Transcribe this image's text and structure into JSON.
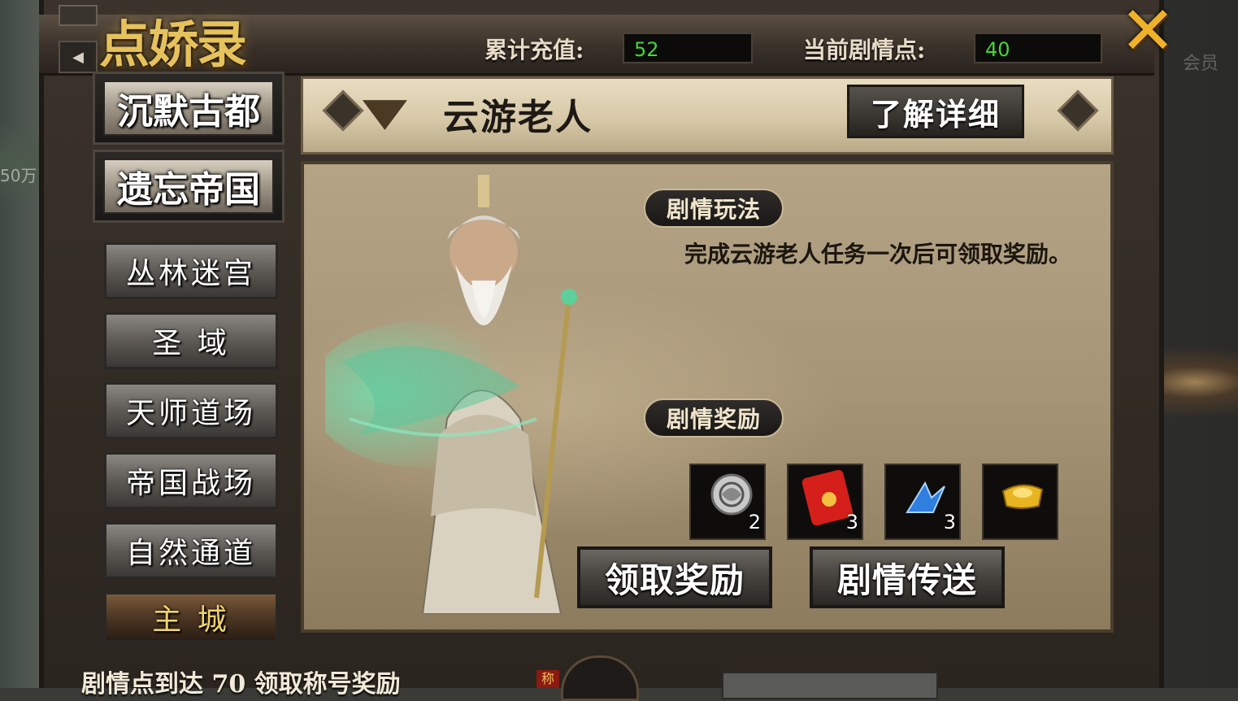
{
  "window": {
    "title": "点娇录",
    "background_left_text": "50万",
    "background_right_text": "会员"
  },
  "header": {
    "recharge_label": "累计充值:",
    "recharge_value": "52",
    "story_points_label": "当前剧情点:",
    "story_points_value": "40"
  },
  "sidebar": {
    "maps": [
      {
        "label": "沉默古都"
      },
      {
        "label": "遗忘帝国"
      }
    ],
    "areas": [
      {
        "label": "丛林迷宫"
      },
      {
        "label": "圣  域"
      },
      {
        "label": "天师道场"
      },
      {
        "label": "帝国战场"
      },
      {
        "label": "自然通道"
      },
      {
        "label": "主  城"
      }
    ]
  },
  "content": {
    "npc_name": "云游老人",
    "detail_button": "了解详细",
    "gameplay_tag": "剧情玩法",
    "description": "完成云游老人任务一次后可领取奖励。",
    "reward_tag": "剧情奖励",
    "rewards": [
      {
        "icon": "dragon-coin-icon",
        "count": "2"
      },
      {
        "icon": "red-envelope-icon",
        "count": "3"
      },
      {
        "icon": "blue-crystal-icon",
        "count": "3"
      },
      {
        "icon": "gold-ingot-icon",
        "count": ""
      }
    ],
    "claim_button": "领取奖励",
    "teleport_button": "剧情传送"
  },
  "footer": {
    "tip": "剧情点到达 70 领取称号奖励",
    "badge": "称"
  },
  "colors": {
    "title_gold": "#e6c25c",
    "value_green": "#49d43a",
    "close_orange": "#f0b12a"
  }
}
